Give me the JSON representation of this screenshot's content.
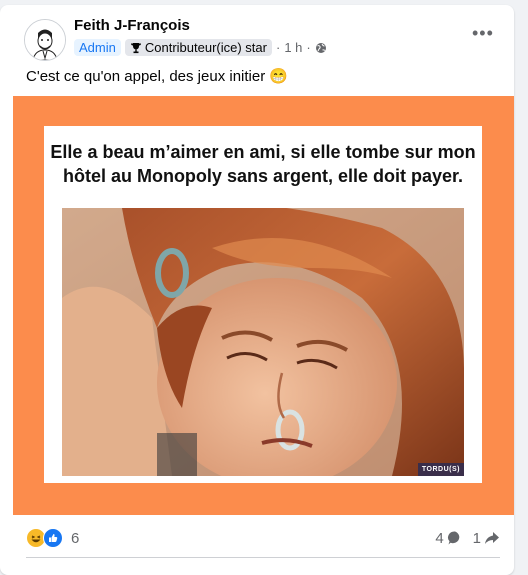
{
  "post": {
    "author": "Feith J-François",
    "role_badge": "Admin",
    "contributor_badge": "Contributeur(ice) star",
    "time": "1 h",
    "separator": "·",
    "more_label": "•••",
    "text": "C'est ce qu'on appel, des jeux initier",
    "text_emoji": "😁"
  },
  "meme": {
    "caption_line1": "Elle a beau m’aimer en ami, si elle tombe sur mon",
    "caption_line2": "hôtel au Monopoly sans argent, elle doit payer.",
    "watermark": "TORDU(S)",
    "background_color": "#fc8c4c"
  },
  "stats": {
    "reaction_count": "6",
    "comment_count": "4",
    "share_count": "1",
    "reaction_icons": [
      "laugh-reaction-icon",
      "like-reaction-icon"
    ]
  },
  "colors": {
    "admin_blue": "#1877f2",
    "muted_text": "#65676b"
  }
}
